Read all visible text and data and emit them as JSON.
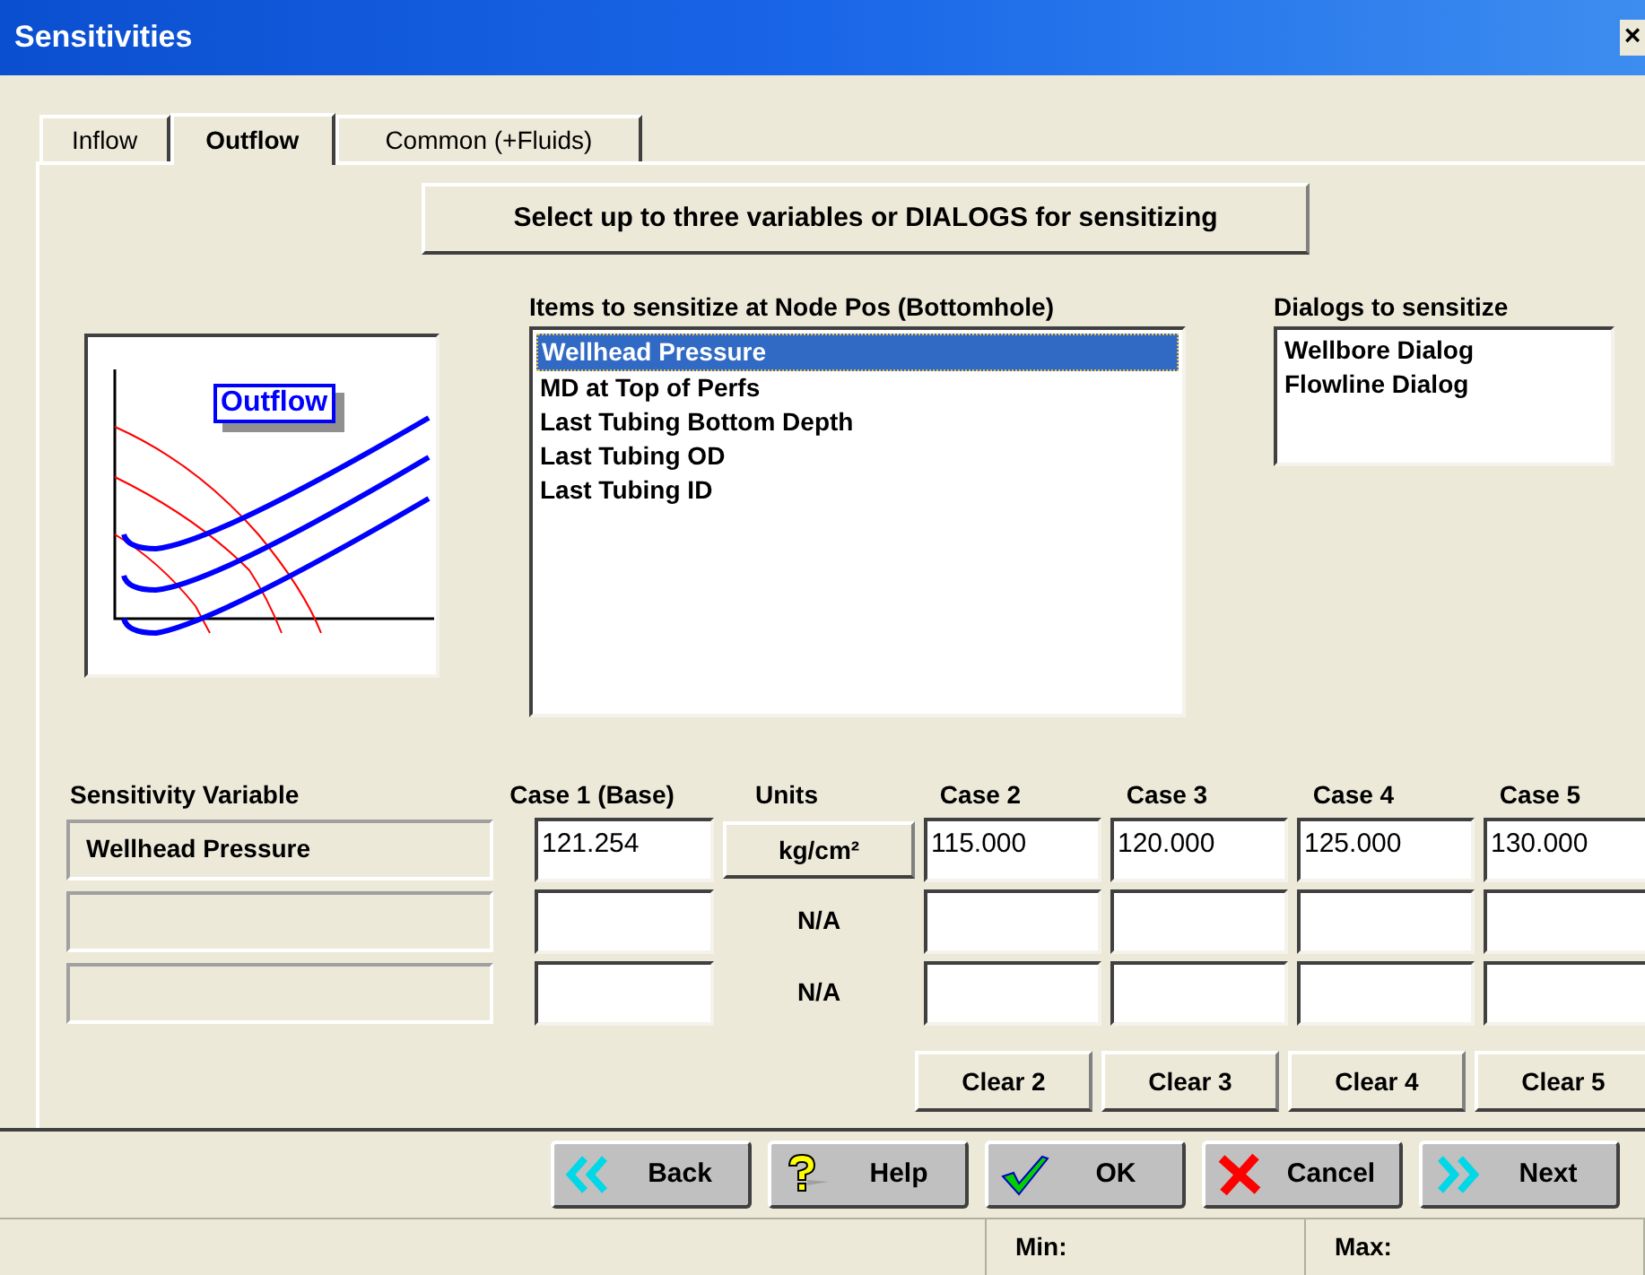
{
  "window": {
    "title": "Sensitivities",
    "close": "×"
  },
  "tabs": [
    {
      "label": "Inflow",
      "selected": false
    },
    {
      "label": "Outflow",
      "selected": true
    },
    {
      "label": "Common (+Fluids)",
      "selected": false
    }
  ],
  "instruction_button": "Select up to three variables or DIALOGS for sensitizing",
  "chart_label": "Outflow",
  "items_list": {
    "heading": "Items to sensitize at Node Pos (Bottomhole)",
    "items": [
      {
        "label": "Wellhead Pressure",
        "selected": true
      },
      {
        "label": "MD at Top of Perfs",
        "selected": false
      },
      {
        "label": "Last Tubing Bottom Depth",
        "selected": false
      },
      {
        "label": "Last Tubing OD",
        "selected": false
      },
      {
        "label": "Last Tubing ID",
        "selected": false
      }
    ]
  },
  "dialogs_list": {
    "heading": "Dialogs to sensitize",
    "items": [
      {
        "label": "Wellbore Dialog",
        "selected": false
      },
      {
        "label": "Flowline Dialog",
        "selected": false
      }
    ]
  },
  "table": {
    "columns": [
      "Sensitivity Variable",
      "Case 1 (Base)",
      "Units",
      "Case 2",
      "Case 3",
      "Case 4",
      "Case 5"
    ],
    "rows": [
      {
        "variable": "Wellhead Pressure",
        "base": "121.254",
        "units": {
          "kind": "button",
          "label": "kg/cm²"
        },
        "cases": [
          "115.000",
          "120.000",
          "125.000",
          "130.000"
        ]
      },
      {
        "units": {
          "kind": "text",
          "label": "N/A"
        }
      },
      {
        "units": {
          "kind": "text",
          "label": "N/A"
        }
      }
    ]
  },
  "clear_buttons": [
    "Clear 2",
    "Clear 3",
    "Clear 4",
    "Clear 5"
  ],
  "buttons": [
    {
      "kind": "back",
      "label": "Back"
    },
    {
      "kind": "help",
      "label": "Help"
    },
    {
      "kind": "ok",
      "label": "OK"
    },
    {
      "kind": "cancel",
      "label": "Cancel"
    },
    {
      "kind": "next",
      "label": "Next"
    }
  ],
  "status_bar": [
    "Min:",
    "Max:"
  ]
}
